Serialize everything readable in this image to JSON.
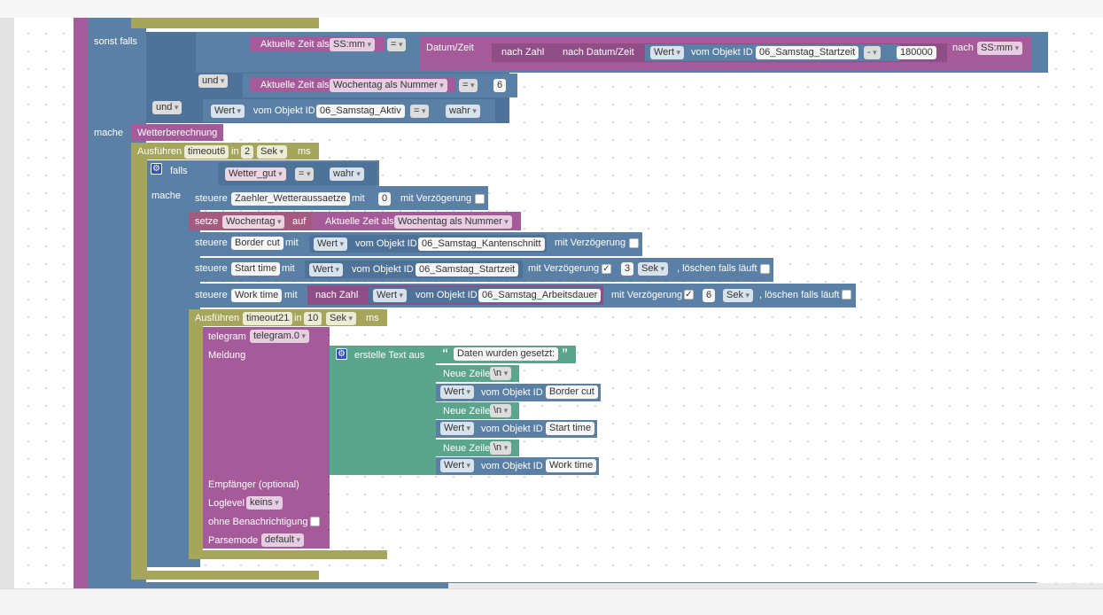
{
  "blocks": {
    "sonst_falls": "sonst falls",
    "aktuelle_zeit_als": "Aktuelle Zeit als",
    "format_ssmm": "SS:mm",
    "op_eq": "=",
    "datum_zeit": "Datum/Zeit",
    "nach_zahl": "nach Zahl",
    "nach_datum_zeit": "nach Datum/Zeit",
    "wert": "Wert",
    "vom_objekt_id": "vom Objekt ID",
    "obj_startzeit": "06_Samstag_Startzeit",
    "op_minus": "-",
    "num_180000": "180000",
    "nach": "nach",
    "und": "und",
    "wochentag_als_nummer": "Wochentag als Nummer",
    "num_6": "6",
    "obj_aktiv": "06_Samstag_Aktiv",
    "wahr": "wahr",
    "mache": "mache",
    "wetterberechnung": "Wetterberechnung",
    "ausfuehren": "Ausführen",
    "timeout6": "timeout6",
    "in": "in",
    "num_2": "2",
    "sek": "Sek",
    "ms": "ms",
    "falls": "falls",
    "wetter_gut": "Wetter_gut",
    "steuere": "steuere",
    "zaehler": "Zaehler_Wetteraussaetze",
    "mit": "mit",
    "num_0": "0",
    "mit_verzoegerung": "mit Verzögerung",
    "setze": "setze",
    "wochentag": "Wochentag",
    "auf": "auf",
    "border_cut": "Border cut",
    "obj_kantenschnitt": "06_Samstag_Kantenschnitt",
    "start_time": "Start time",
    "num_3": "3",
    "loeschen_falls_laeuft": ", löschen falls läuft",
    "work_time": "Work time",
    "obj_arbeitsdauer": "06_Samstag_Arbeitsdauer",
    "timeout21": "timeout21",
    "num_10": "10",
    "telegram": "telegram",
    "telegram_instance": "telegram.0",
    "meldung": "Meldung",
    "erstelle_text_aus": "erstelle Text aus",
    "daten_text": "Daten wurden gesetzt:",
    "neue_zeile": "Neue Zeile",
    "newline": "\\n",
    "empfaenger": "Empfänger (optional)",
    "loglevel": "Loglevel",
    "keins": "keins",
    "ohne_benachrichtigung": "ohne Benachrichtigung",
    "parsemode": "Parsemode",
    "default": "default",
    "checkmark": "✓"
  }
}
